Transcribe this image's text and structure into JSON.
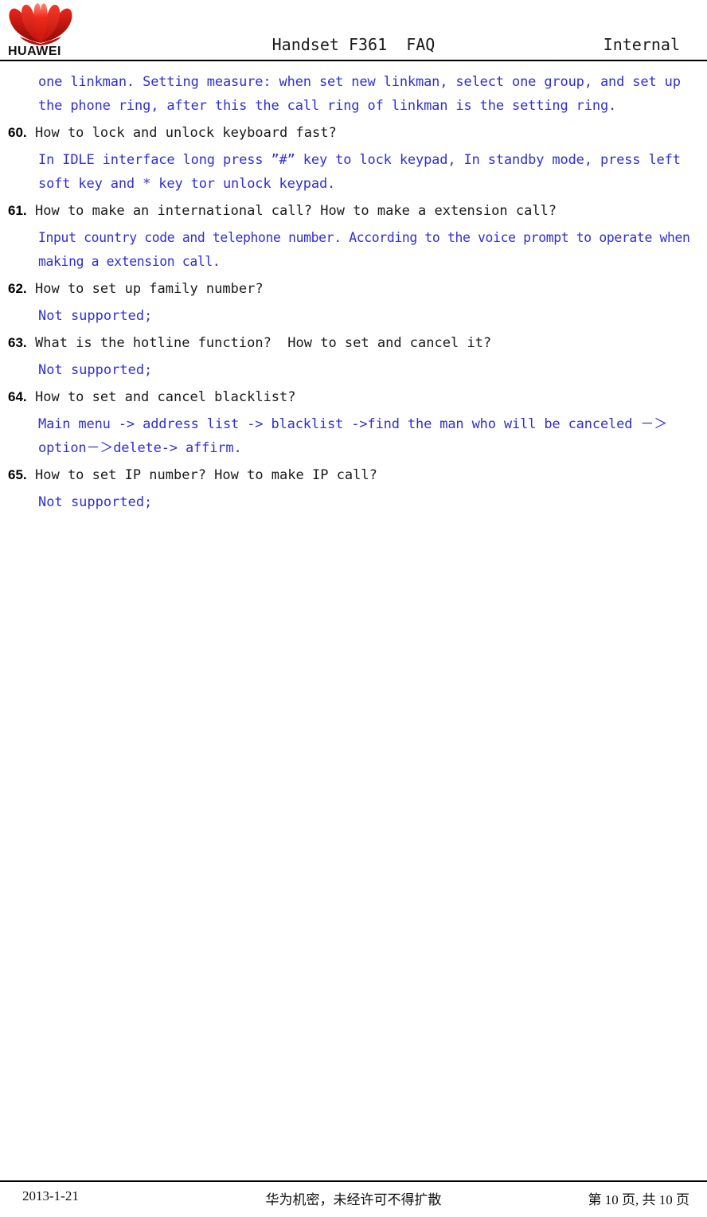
{
  "header": {
    "logo_word": "HUAWEI",
    "logo_icon": "huawei-flower-logo",
    "title": "Handset F361  FAQ",
    "classification": "Internal"
  },
  "content": {
    "continued_answer": "one linkman. Setting measure: when set new linkman, select one group, and set up the phone ring, after this the call ring of linkman is the setting ring.",
    "faqs": [
      {
        "number": "60.",
        "question": "How to lock and unlock keyboard fast?",
        "answer": "In IDLE interface long press ”#” key to lock keypad, In standby mode, press left soft key and * key tor unlock keypad."
      },
      {
        "number": "61.",
        "question": "How to make an international call? How to make a extension call?",
        "answer": "Input country code and telephone number. According to the voice prompt to operate when making a extension call."
      },
      {
        "number": "62.",
        "question": "How to set up family number?",
        "answer": "Not supported;"
      },
      {
        "number": "63.",
        "question": "What is the hotline function?  How to set and cancel it?",
        "answer": "Not supported;"
      },
      {
        "number": "64.",
        "question": "How to set and cancel blacklist?",
        "answer": "Main menu -> address list -> blacklist ->find the man who will be canceled －＞option－＞delete-> affirm."
      },
      {
        "number": "65.",
        "question": "How to set IP number? How to make IP call?",
        "answer": "Not supported;"
      }
    ]
  },
  "footer": {
    "date": "2013-1-21",
    "confidential_notice": "华为机密，未经许可不得扩散",
    "page_info": "第 10 页, 共 10 页"
  },
  "colors": {
    "answer_blue": "#2f2fd4",
    "logo_red": "#e2231a",
    "text_black": "#1a1a1a"
  }
}
